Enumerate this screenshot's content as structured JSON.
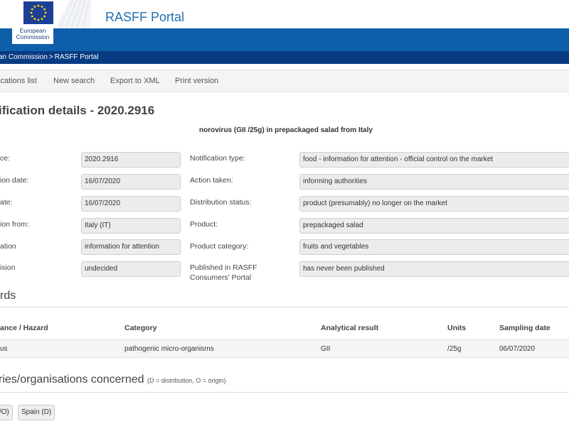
{
  "header": {
    "logo_line1": "European",
    "logo_line2": "Commission",
    "site_title": "RASFF Portal"
  },
  "breadcrumb": {
    "item1": "an Commission",
    "separator": ">",
    "item2": "RASFF Portal"
  },
  "toolbar": {
    "notifications_list": "ications list",
    "new_search": "New search",
    "export_xml": "Export to XML",
    "print_version": "Print version"
  },
  "page_title": "ification details - 2020.2916",
  "subject": "norovirus (GII /25g) in prepackaged salad from Italy",
  "details_left": [
    {
      "label": "ce:",
      "value": "2020.2916"
    },
    {
      "label": "ion date:",
      "value": "16/07/2020"
    },
    {
      "label": "ate:",
      "value": "16/07/2020"
    },
    {
      "label": "ion from:",
      "value": "Italy (IT)"
    },
    {
      "label": "ation",
      "value": "information for attention"
    },
    {
      "label": "ision",
      "value": "undecided"
    }
  ],
  "details_right": [
    {
      "label": "Notification type:",
      "value": "food - information for attention - official control on the market"
    },
    {
      "label": "Action taken:",
      "value": "informing authorities"
    },
    {
      "label": "Distribution status:",
      "value": "product (presumably) no longer on the market"
    },
    {
      "label": "Product:",
      "value": "prepackaged salad"
    },
    {
      "label": "Product category:",
      "value": "fruits and vegetables"
    },
    {
      "label": "Published in RASFF Consumers' Portal",
      "label_line1": "Published in RASFF",
      "label_line2": "Consumers' Portal",
      "value": "has never been published"
    }
  ],
  "hazards": {
    "heading": "rds",
    "columns": [
      "ance / Hazard",
      "Category",
      "Analytical result",
      "Units",
      "Sampling date"
    ],
    "rows": [
      [
        "us",
        "pathogenic micro-organisms",
        "GII",
        "/25g",
        "06/07/2020"
      ]
    ]
  },
  "countries": {
    "heading": "ries/organisations concerned",
    "note": "(D = distribution, O = origin)",
    "tags": [
      "/O)",
      "Spain (D)"
    ]
  },
  "colors": {
    "brand_blue": "#0e5faa",
    "breadcrumb_bg": "#073b82",
    "title_blue": "#1f6fb2",
    "eu_flag": "#1d3f96",
    "eu_star": "#ffdd00"
  }
}
